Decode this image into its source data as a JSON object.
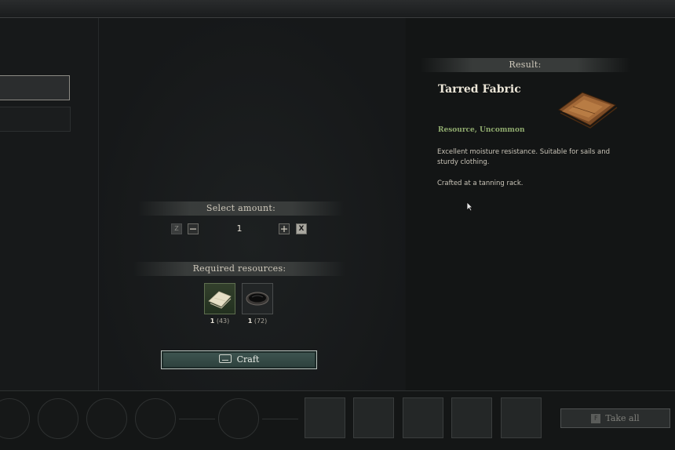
{
  "amount": {
    "header": "Select amount:",
    "key_hint": "Z",
    "decrement_icon": "minus",
    "value": "1",
    "increment_icon": "plus",
    "close_label": "X"
  },
  "resources": {
    "header": "Required resources:",
    "items": [
      {
        "icon": "fabric-icon",
        "required": "1",
        "owned": "(43)"
      },
      {
        "icon": "tar-bowl-icon",
        "required": "1",
        "owned": "(72)"
      }
    ]
  },
  "craft_button": {
    "label": "Craft",
    "key_icon": "spacebar-icon"
  },
  "result": {
    "header": "Result:",
    "name": "Tarred Fabric",
    "rarity": "Resource, Uncommon",
    "description": "Excellent moisture resistance. Suitable for sails and sturdy clothing.",
    "note": "Crafted at a tanning rack.",
    "icon": "tarred-fabric-icon"
  },
  "take_all": {
    "key": "F",
    "label": "Take all"
  },
  "colors": {
    "accent_green": "#8faa6e",
    "craft_button": "#3f5652"
  }
}
